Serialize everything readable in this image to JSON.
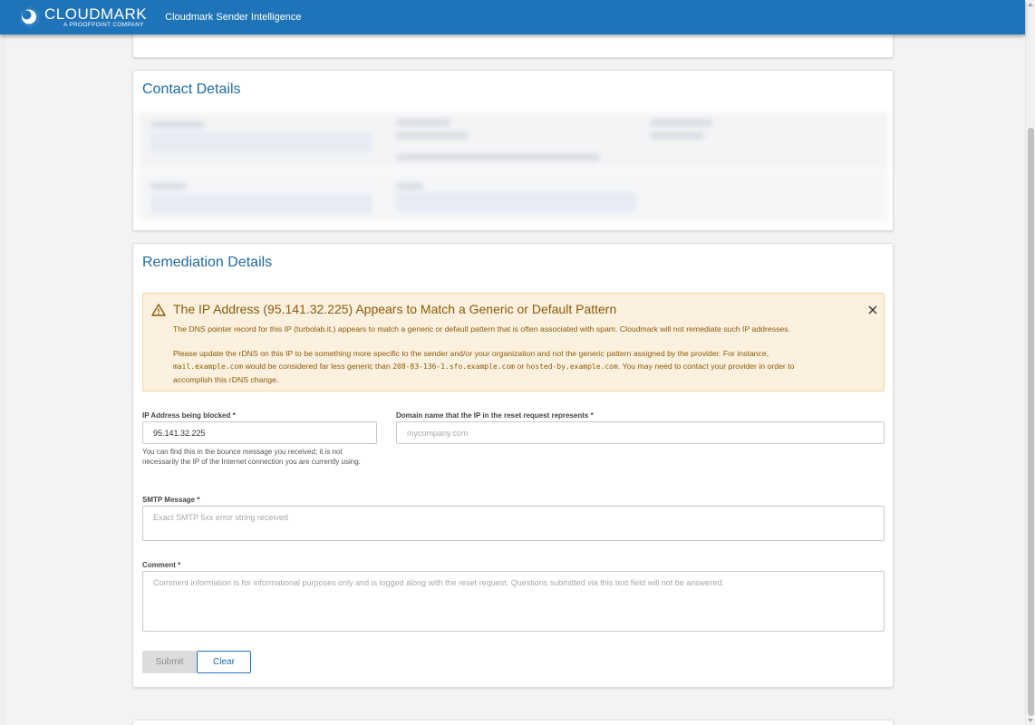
{
  "header": {
    "logo_name": "CLOUDMARK",
    "logo_sub": "A PROOFPOINT COMPANY",
    "app_title": "Cloudmark Sender Intelligence",
    "bar_color": "#1f74b9"
  },
  "contact": {
    "title": "Contact Details"
  },
  "remediation": {
    "title": "Remediation Details",
    "alert": {
      "icon": "warning-icon",
      "title": "The IP Address (95.141.32.225) Appears to Match a Generic or Default Pattern",
      "p1": "The DNS pointer record for this IP (turbolab.it.) appears to match a generic or default pattern that is often associated with spam. Cloudmark will not remediate such IP addresses.",
      "p2_a": "Please update the rDNS on this IP to be something more specific to the sender and/or your organization and not the generic pattern assigned by the provider. For instance,",
      "ex1": "mail.example.com",
      "p2_b": " would be considered far less generic than ",
      "ex2": "208-83-136-1.sfo.example.com",
      "p2_c": " or ",
      "ex3": "hosted-by.example.com",
      "p2_d": ". You may need to contact your provider in order to accomplish this rDNS change.",
      "close_icon": "close-icon"
    },
    "form": {
      "ip_label": "IP Address being blocked *",
      "ip_value": "95.141.32.225",
      "ip_help": "You can find this in the bounce message you received; it is not necessarily the IP of the Internet connection you are currently using.",
      "domain_label": "Domain name that the IP in the reset request represents *",
      "domain_placeholder": "mycompany.com",
      "smtp_label": "SMTP Message *",
      "smtp_placeholder": "Exact SMTP 5xx error string received",
      "comment_label": "Comment *",
      "comment_placeholder": "Comment information is for informational purposes only and is logged along with the reset request. Questions submitted via this text field will not be answered.",
      "submit_label": "Submit",
      "clear_label": "Clear"
    }
  }
}
